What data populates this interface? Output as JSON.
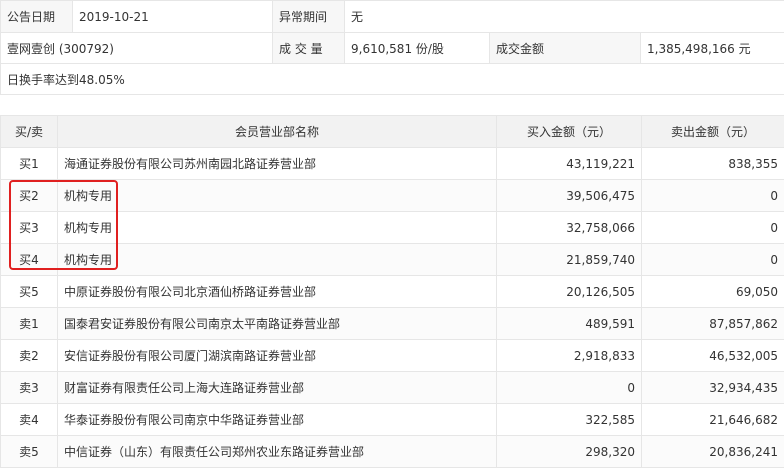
{
  "info": {
    "date_label": "公告日期",
    "date_value": "2019-10-21",
    "period_label": "异常期间",
    "period_value": "无",
    "stock": "壹网壹创 (300792)",
    "volume_label": "成 交 量",
    "volume_value": "9,610,581 份/股",
    "amount_label": "成交金额",
    "amount_value": "1,385,498,166 元",
    "note": "日换手率达到48.05%"
  },
  "table": {
    "headers": [
      "买/卖",
      "会员营业部名称",
      "买入金额（元）",
      "卖出金额（元）"
    ],
    "rows": [
      {
        "bs": "买1",
        "name": "海通证券股份有限公司苏州南园北路证券营业部",
        "buy": "43,119,221",
        "sell": "838,355"
      },
      {
        "bs": "买2",
        "name": "机构专用",
        "buy": "39,506,475",
        "sell": "0"
      },
      {
        "bs": "买3",
        "name": "机构专用",
        "buy": "32,758,066",
        "sell": "0"
      },
      {
        "bs": "买4",
        "name": "机构专用",
        "buy": "21,859,740",
        "sell": "0"
      },
      {
        "bs": "买5",
        "name": "中原证券股份有限公司北京酒仙桥路证券营业部",
        "buy": "20,126,505",
        "sell": "69,050"
      },
      {
        "bs": "卖1",
        "name": "国泰君安证券股份有限公司南京太平南路证券营业部",
        "buy": "489,591",
        "sell": "87,857,862"
      },
      {
        "bs": "卖2",
        "name": "安信证券股份有限公司厦门湖滨南路证券营业部",
        "buy": "2,918,833",
        "sell": "46,532,005"
      },
      {
        "bs": "卖3",
        "name": "财富证券有限责任公司上海大连路证券营业部",
        "buy": "0",
        "sell": "32,934,435"
      },
      {
        "bs": "卖4",
        "name": "华泰证券股份有限公司南京中华路证券营业部",
        "buy": "322,585",
        "sell": "21,646,682"
      },
      {
        "bs": "卖5",
        "name": "中信证券（山东）有限责任公司郑州农业东路证券营业部",
        "buy": "298,320",
        "sell": "20,836,241"
      }
    ]
  },
  "colors": {
    "highlight_border": "#e02020",
    "label_bg": "#f7f7f7",
    "header_bg": "#f2f2f2"
  }
}
